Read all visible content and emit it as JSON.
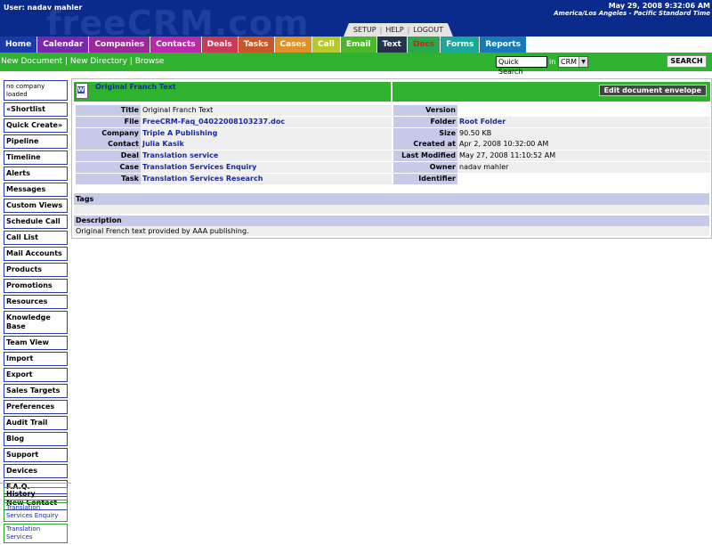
{
  "header": {
    "user": "User: nadav mahler",
    "date": "May 29, 2008 9:32:06 AM",
    "timezone": "America/Los Angeles - Pacific Standard Time",
    "watermark": "freeCRM.com",
    "utility": {
      "setup": "SETUP",
      "help": "HELP",
      "logout": "LOGOUT"
    }
  },
  "nav": {
    "tabs": [
      {
        "label": "Home",
        "color": "#1a3aa8"
      },
      {
        "label": "Calendar",
        "color": "#7a2aa8"
      },
      {
        "label": "Companies",
        "color": "#9a2a9a"
      },
      {
        "label": "Contacts",
        "color": "#b82aa8"
      },
      {
        "label": "Deals",
        "color": "#c83a5a"
      },
      {
        "label": "Tasks",
        "color": "#c4582a"
      },
      {
        "label": "Cases",
        "color": "#e0902a"
      },
      {
        "label": "Call",
        "color": "#b8c82a"
      },
      {
        "label": "Email",
        "color": "#4ab82a"
      },
      {
        "label": "Text",
        "color": "#24324a"
      },
      {
        "label": "Docs",
        "color": "#2aa84a",
        "text_color": "#d02020"
      },
      {
        "label": "Forms",
        "color": "#1aa89a"
      },
      {
        "label": "Reports",
        "color": "#1a7ab8"
      }
    ]
  },
  "subnav": {
    "new_document": "New Document",
    "sep": "|",
    "new_directory": "New Directory",
    "browse": "Browse",
    "search_value": "Quick Search",
    "in_label": "in",
    "search_scope": "CRM",
    "search_button": "SEARCH"
  },
  "sidebar": {
    "info": "no company loaded",
    "items": [
      "«Shortlist",
      "Quick Create»",
      "Pipeline",
      "Timeline",
      "Alerts",
      "Messages",
      "Custom Views",
      "Schedule Call",
      "Call List",
      "Mail Accounts",
      "Products",
      "Promotions",
      "Resources",
      "Knowledge Base",
      "Team View",
      "Import",
      "Export",
      "Sales Targets",
      "Preferences",
      "Audit Trail",
      "Blog",
      "Support",
      "Devices",
      "F.A.Q.",
      "New Contact"
    ],
    "history_title": "History",
    "history": [
      "Translation Services Enquiry",
      "Translation Services"
    ]
  },
  "document": {
    "title": "Original Franch Text",
    "edit_button": "Edit document envelope",
    "left": [
      {
        "label": "Title",
        "value": "Original Franch Text",
        "link": false
      },
      {
        "label": "File",
        "value": "FreeCRM-Faq_04022008103237.doc",
        "link": true
      },
      {
        "label": "Company",
        "value": "Triple A Publishing",
        "link": true
      },
      {
        "label": "Contact",
        "value": "Julia Kasik",
        "link": true
      },
      {
        "label": "Deal",
        "value": "Translation service",
        "link": true
      },
      {
        "label": "Case",
        "value": "Translation Services Enquiry",
        "link": true
      },
      {
        "label": "Task",
        "value": "Translation Services Research",
        "link": true
      }
    ],
    "right": [
      {
        "label": "Version",
        "value": "",
        "link": false
      },
      {
        "label": "Folder",
        "value": "Root Folder",
        "link": true
      },
      {
        "label": "Size",
        "value": "90.50 KB",
        "link": false
      },
      {
        "label": "Created at",
        "value": "Apr 2, 2008 10:32:00 AM",
        "link": false
      },
      {
        "label": "Last Modified",
        "value": "May 27, 2008 11:10:52 AM",
        "link": false
      },
      {
        "label": "Owner",
        "value": "nadav mahler",
        "link": false
      },
      {
        "label": "Identifier",
        "value": "",
        "link": false
      }
    ],
    "tags_label": "Tags",
    "description_label": "Description",
    "description": "Original French text provided by AAA publishing."
  }
}
